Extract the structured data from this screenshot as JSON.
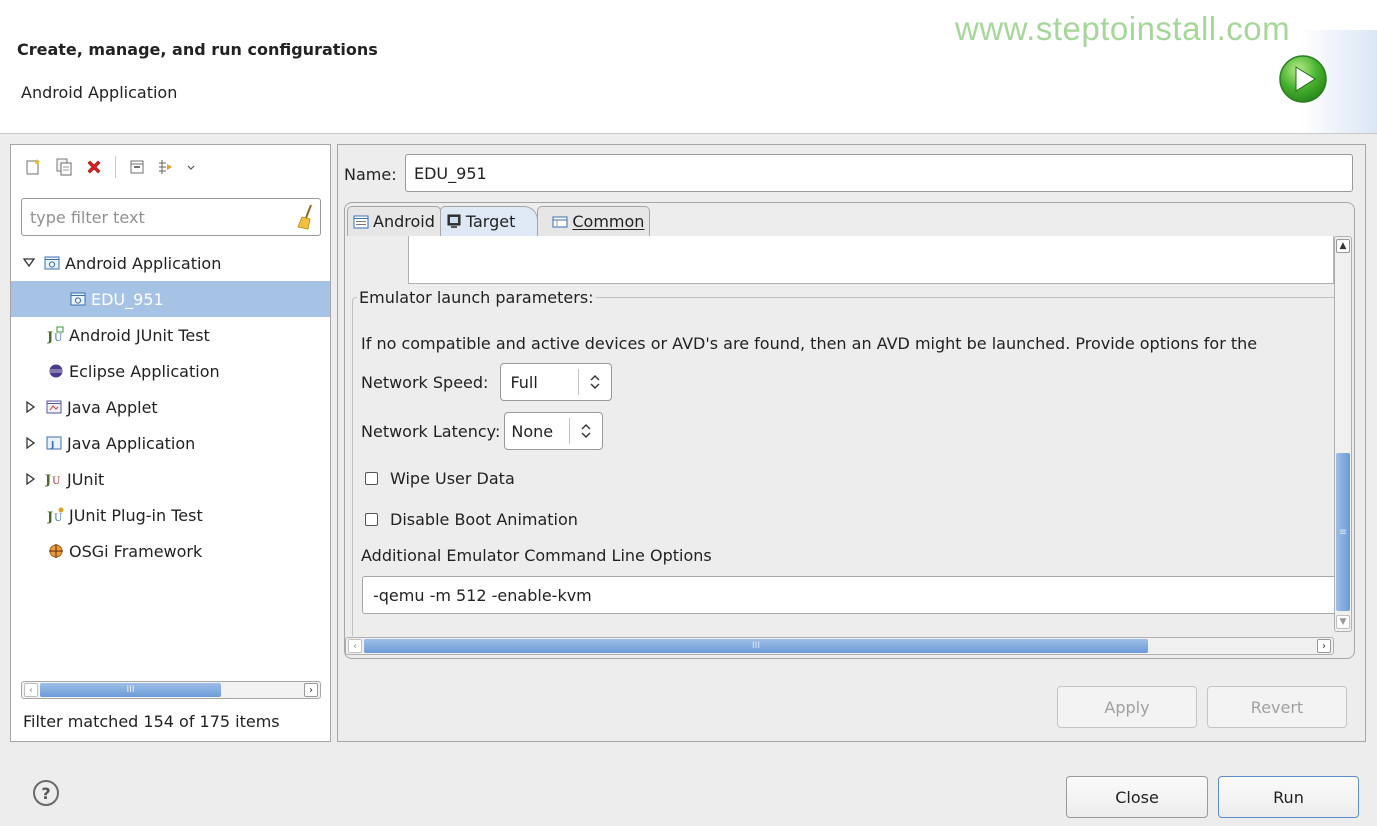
{
  "header": {
    "title": "Create, manage, and run configurations",
    "subtitle": "Android Application",
    "watermark": "www.steptoinstall.com",
    "run_icon": "run-play-icon",
    "accent": "#3fa62c"
  },
  "toolbar": {
    "icons": [
      "new-configuration-icon",
      "duplicate-icon",
      "delete-icon",
      "collapse-all-icon",
      "filter-icon",
      "view-menu-chevron-icon"
    ]
  },
  "filter": {
    "placeholder": "type filter text",
    "value": ""
  },
  "tree": {
    "items": [
      {
        "label": "Android Application",
        "expanded": true,
        "icon": "android-app-icon"
      },
      {
        "label": "EDU_951",
        "selected": true,
        "icon": "android-app-icon"
      },
      {
        "label": "Android JUnit Test",
        "icon": "android-junit-icon"
      },
      {
        "label": "Eclipse Application",
        "icon": "eclipse-icon"
      },
      {
        "label": "Java Applet",
        "collapsed": true,
        "icon": "java-applet-icon"
      },
      {
        "label": "Java Application",
        "collapsed": true,
        "icon": "java-application-icon"
      },
      {
        "label": "JUnit",
        "collapsed": true,
        "icon": "junit-icon"
      },
      {
        "label": "JUnit Plug-in Test",
        "icon": "junit-plugin-icon"
      },
      {
        "label": "OSGi Framework",
        "icon": "osgi-icon"
      }
    ]
  },
  "filter_status": "Filter matched 154 of 175 items",
  "config": {
    "name_label": "Name:",
    "name_value": "EDU_951",
    "tabs": [
      {
        "label": "Android",
        "icon": "android-tab-icon"
      },
      {
        "label": "Target",
        "icon": "target-monitor-icon",
        "active": true
      },
      {
        "label": "Common",
        "icon": "common-tab-icon",
        "mnemonic": "C"
      }
    ],
    "emulator": {
      "group_title": "Emulator launch parameters:",
      "description": "If no compatible and active devices or AVD's are found, then an AVD might be launched. Provide options for the",
      "network_speed_label": "Network Speed:",
      "network_speed_value": "Full",
      "network_latency_label": "Network Latency:",
      "network_latency_value": "None",
      "wipe_label": "Wipe User Data",
      "wipe_checked": false,
      "boot_anim_label": "Disable Boot Animation",
      "boot_anim_checked": false,
      "cmd_label": "Additional Emulator Command Line Options",
      "cmd_value": "-qemu -m 512 -enable-kvm"
    }
  },
  "buttons": {
    "apply": "Apply",
    "revert": "Revert",
    "close": "Close",
    "run": "Run",
    "help": "?"
  }
}
